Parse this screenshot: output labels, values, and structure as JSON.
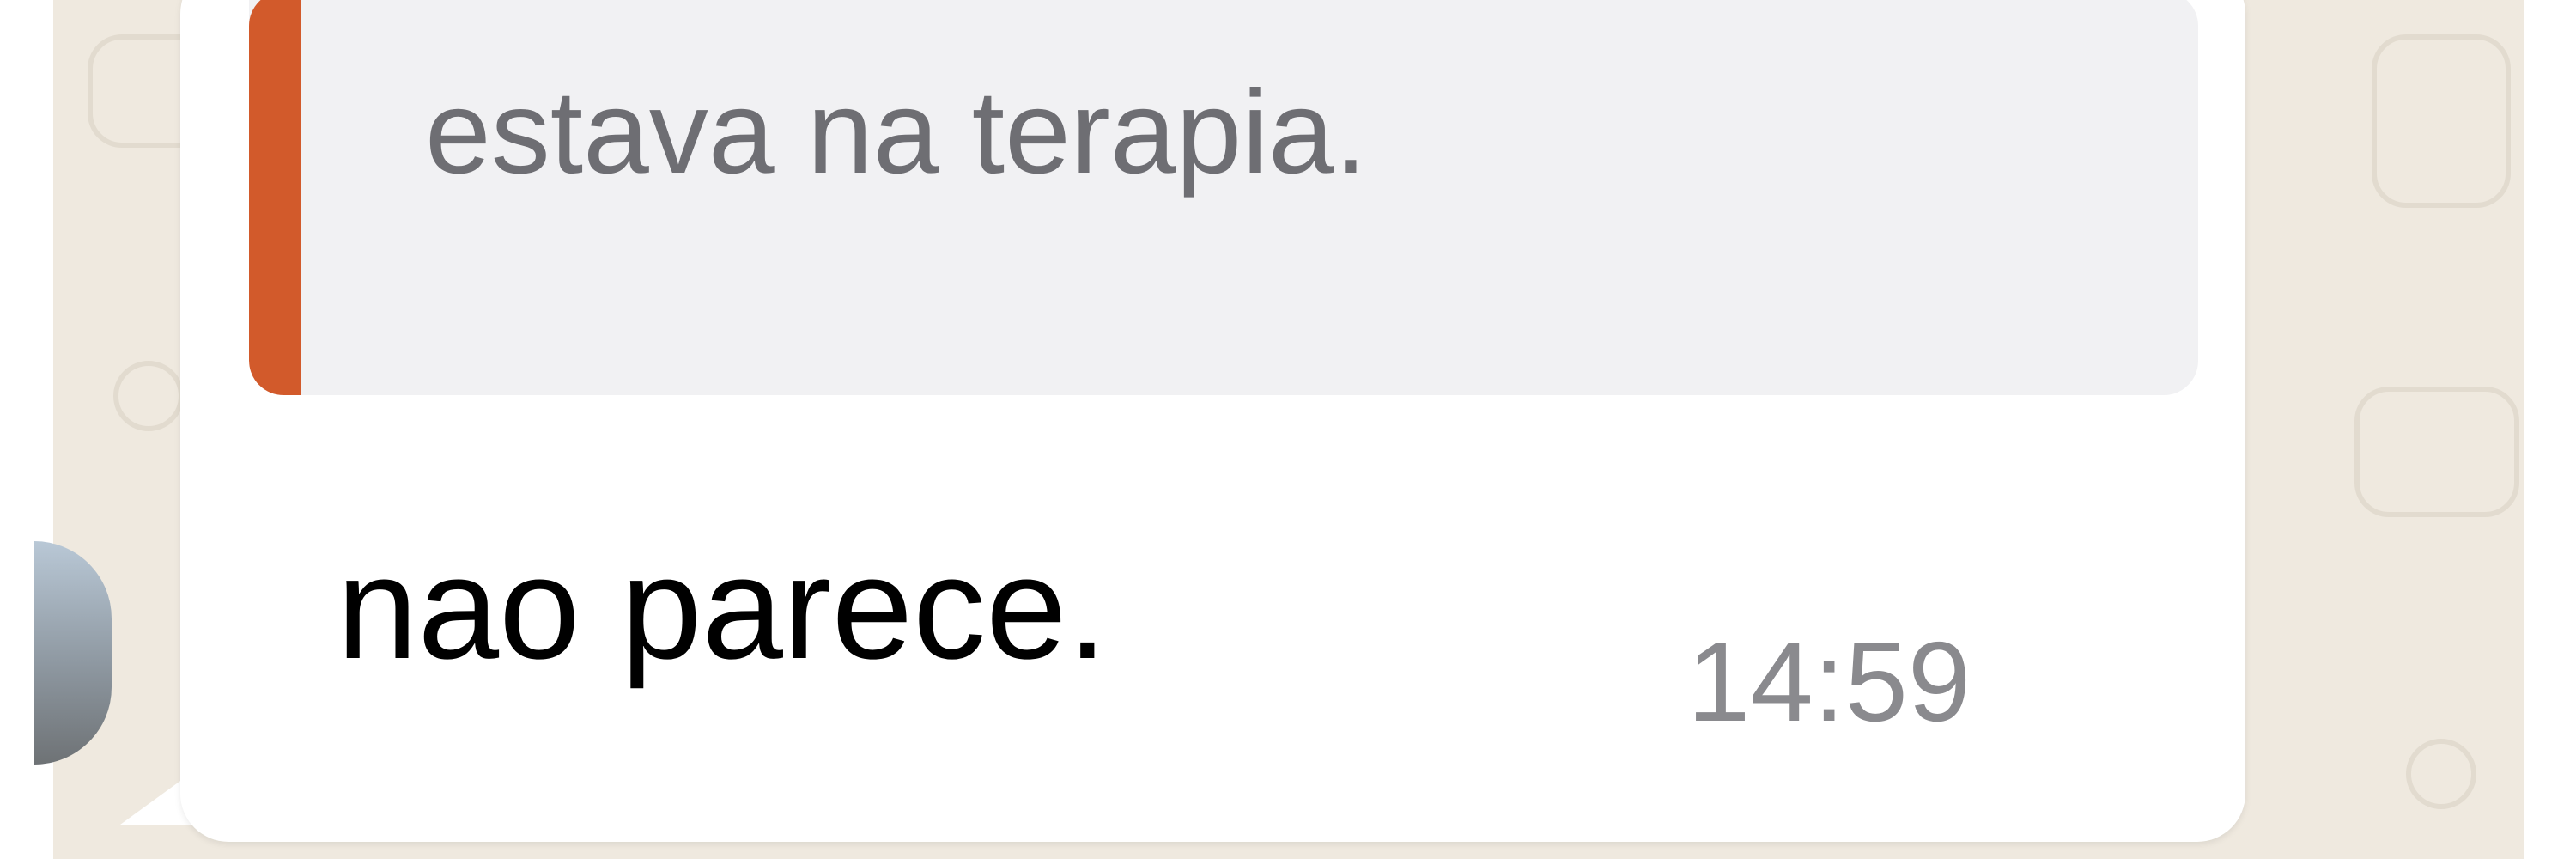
{
  "chat": {
    "quoted_message": {
      "text": "estava na terapia.",
      "accent_color": "#d25a2b"
    },
    "message": {
      "text": "nao parece.",
      "time": "14:59"
    }
  },
  "colors": {
    "background": "#efe9df",
    "bubble": "#ffffff",
    "quote_background": "#f1f1f3",
    "quote_text": "#6e6e73",
    "message_text": "#000000",
    "timestamp_text": "#8a8a8e"
  }
}
